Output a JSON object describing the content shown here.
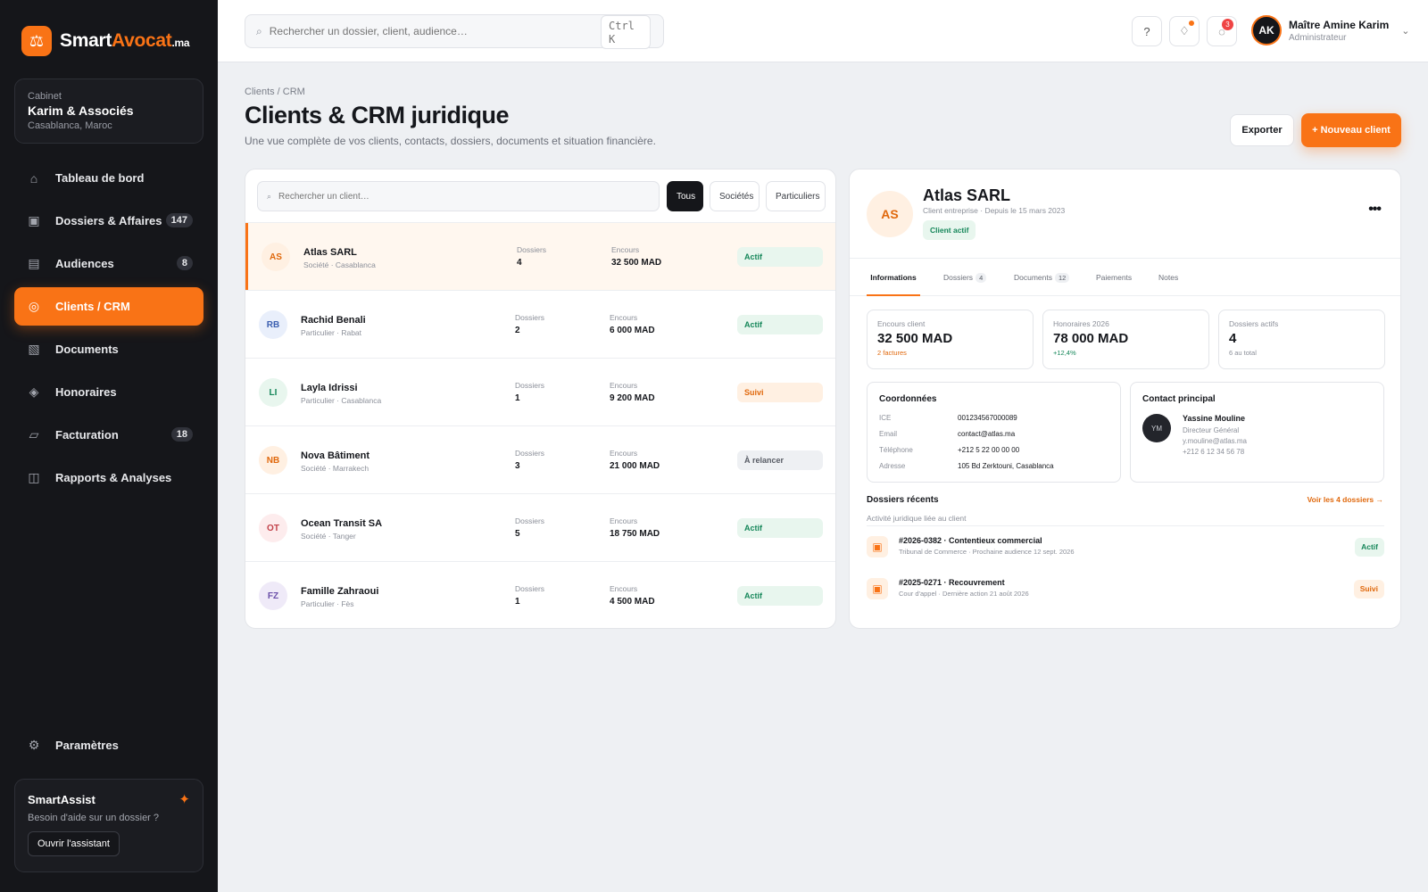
{
  "brand": {
    "first": "Smart",
    "second": "Avocat",
    "tld": ".ma",
    "logo_icon": "scale-icon"
  },
  "cabinet": {
    "label": "Cabinet",
    "name": "Karim & Associés",
    "location": "Casablanca, Maroc"
  },
  "nav": {
    "items": [
      {
        "label": "Tableau de bord",
        "icon": "home-icon",
        "glyph": "⌂"
      },
      {
        "label": "Dossiers & Affaires",
        "icon": "folder-icon",
        "glyph": "▣",
        "badge": "147"
      },
      {
        "label": "Audiences",
        "icon": "calendar-icon",
        "glyph": "▤",
        "badge": "8"
      },
      {
        "label": "Clients / CRM",
        "icon": "clients-icon",
        "glyph": "◎"
      },
      {
        "label": "Documents",
        "icon": "document-icon",
        "glyph": "▧"
      },
      {
        "label": "Honoraires",
        "icon": "fees-icon",
        "glyph": "◈"
      },
      {
        "label": "Facturation",
        "icon": "invoice-icon",
        "glyph": "▱",
        "badge": "18"
      },
      {
        "label": "Rapports & Analyses",
        "icon": "reports-icon",
        "glyph": "◫"
      }
    ],
    "settings": {
      "label": "Paramètres",
      "glyph": "⚙"
    }
  },
  "assist": {
    "title": "SmartAssist",
    "desc": "Besoin d'aide sur un dossier ?",
    "button": "Ouvrir l'assistant",
    "glyph": "✦"
  },
  "topbar": {
    "search_placeholder": "Rechercher un dossier, client, audience…",
    "shortcut": "Ctrl K",
    "help": "?",
    "notif_count": "3",
    "user": {
      "initials": "AK",
      "name": "Maître Amine Karim",
      "role": "Administrateur"
    }
  },
  "page": {
    "breadcrumb": "Clients / CRM",
    "title": "Clients & CRM juridique",
    "subtitle": "Une vue complète de vos clients, contacts, dossiers, documents et situation financière.",
    "export_label": "Exporter",
    "new_label": "+ Nouveau client"
  },
  "list": {
    "search_placeholder": "Rechercher un client…",
    "filters": [
      "Tous",
      "Sociétés",
      "Particuliers"
    ],
    "dossiers_label": "Dossiers",
    "encours_label": "Encours",
    "clients": [
      {
        "initials": "AS",
        "name": "Atlas SARL",
        "sub": "Société · Casablanca",
        "dossiers": "4",
        "encours": "32 500 MAD",
        "status": "Actif",
        "kind": "actif",
        "bg": "#fff0e2",
        "fg": "#e0680c"
      },
      {
        "initials": "RB",
        "name": "Rachid Benali",
        "sub": "Particulier · Rabat",
        "dossiers": "2",
        "encours": "6 000 MAD",
        "status": "Actif",
        "kind": "actif",
        "bg": "#e9effb",
        "fg": "#3b5fb0"
      },
      {
        "initials": "LI",
        "name": "Layla Idrissi",
        "sub": "Particulier · Casablanca",
        "dossiers": "1",
        "encours": "9 200 MAD",
        "status": "Suivi",
        "kind": "suivi",
        "bg": "#e8f6ee",
        "fg": "#16875a"
      },
      {
        "initials": "NB",
        "name": "Nova Bâtiment",
        "sub": "Société · Marrakech",
        "dossiers": "3",
        "encours": "21 000 MAD",
        "status": "À relancer",
        "kind": "relancer",
        "bg": "#fff0e2",
        "fg": "#e0680c"
      },
      {
        "initials": "OT",
        "name": "Ocean Transit SA",
        "sub": "Société · Tanger",
        "dossiers": "5",
        "encours": "18 750 MAD",
        "status": "Actif",
        "kind": "actif",
        "bg": "#fdeced",
        "fg": "#c24149"
      },
      {
        "initials": "FZ",
        "name": "Famille Zahraoui",
        "sub": "Particulier · Fès",
        "dossiers": "1",
        "encours": "4 500 MAD",
        "status": "Actif",
        "kind": "actif",
        "bg": "#efeaf8",
        "fg": "#6a4fa8"
      }
    ]
  },
  "detail": {
    "initials": "AS",
    "name": "Atlas SARL",
    "sub": "Client entreprise · Depuis le 15 mars 2023",
    "status": "Client actif",
    "more": "•••",
    "tabs": [
      {
        "label": "Informations"
      },
      {
        "label": "Dossiers",
        "count": "4"
      },
      {
        "label": "Documents",
        "count": "12"
      },
      {
        "label": "Paiements"
      },
      {
        "label": "Notes"
      }
    ],
    "kpis": [
      {
        "label": "Encours client",
        "value": "32 500 MAD",
        "note": "2 factures"
      },
      {
        "label": "Honoraires 2026",
        "value": "78 000 MAD",
        "note": "+12,4%"
      },
      {
        "label": "Dossiers actifs",
        "value": "4",
        "note": "6 au total"
      }
    ],
    "coordonnees": {
      "title": "Coordonnées",
      "rows": [
        {
          "k": "ICE",
          "v": "001234567000089"
        },
        {
          "k": "Email",
          "v": "contact@atlas.ma"
        },
        {
          "k": "Téléphone",
          "v": "+212 5 22 00 00 00"
        },
        {
          "k": "Adresse",
          "v": "105 Bd Zerktouni, Casablanca"
        }
      ]
    },
    "contact": {
      "title": "Contact principal",
      "initials": "YM",
      "name": "Yassine Mouline",
      "role": "Directeur Général",
      "email": "y.mouline@atlas.ma",
      "phone": "+212 6 12 34 56 78"
    },
    "recent": {
      "title": "Dossiers récents",
      "link": "Voir les 4 dossiers →",
      "subtitle": "Activité juridique liée au client",
      "items": [
        {
          "title": "#2026-0382 · Contentieux commercial",
          "sub": "Tribunal de Commerce · Prochaine audience 12 sept. 2026",
          "status": "Actif",
          "kind": "actif"
        },
        {
          "title": "#2025-0271 · Recouvrement",
          "sub": "Cour d'appel · Dernière action 21 août 2026",
          "status": "Suivi",
          "kind": "suivi"
        }
      ]
    }
  },
  "colors": {
    "accent": "#f97316",
    "sidebar": "#15161a",
    "success": "#16875a"
  }
}
